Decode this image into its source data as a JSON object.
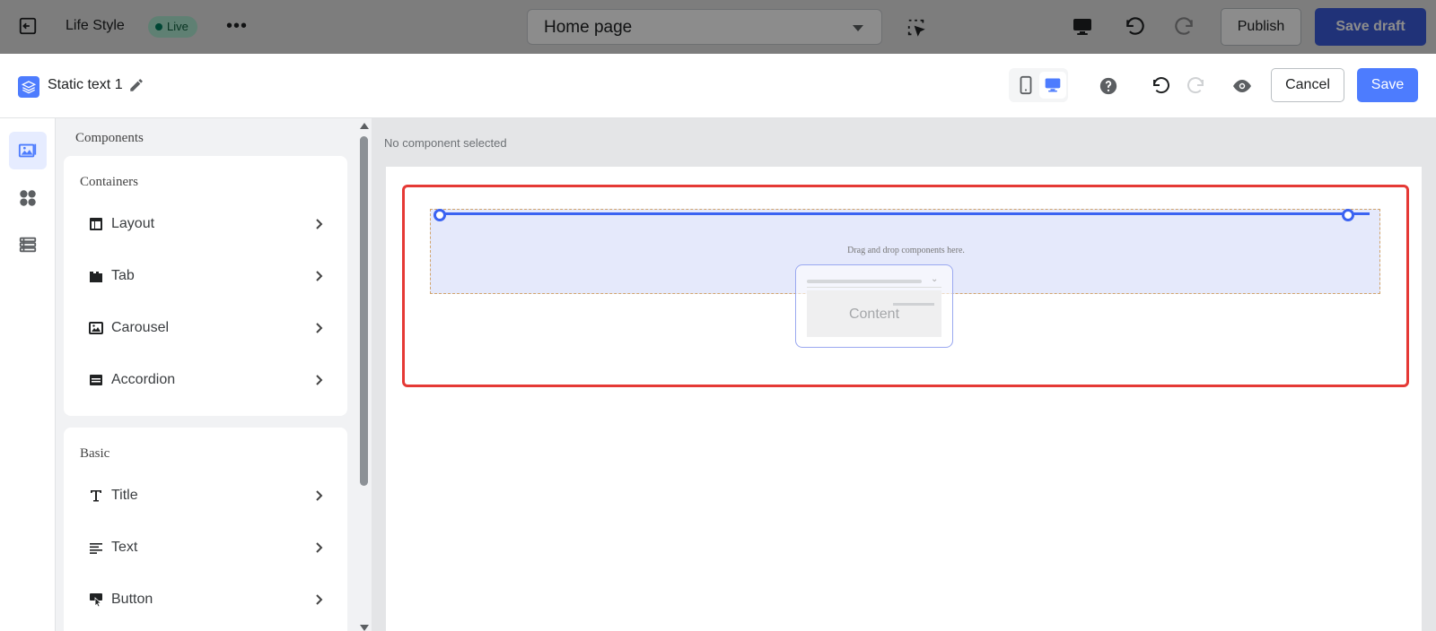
{
  "topbar": {
    "store_name": "Life Style",
    "live_badge": "Live",
    "more_label": "•••",
    "page_select": "Home page",
    "publish_label": "Publish",
    "save_draft_label": "Save draft"
  },
  "editor": {
    "component_name": "Static text 1",
    "cancel_label": "Cancel",
    "save_label": "Save",
    "accent_color": "#4d7cfe"
  },
  "panel": {
    "title": "Components",
    "containers": {
      "title": "Containers",
      "items": [
        {
          "label": "Layout",
          "icon": "layout-icon"
        },
        {
          "label": "Tab",
          "icon": "tab-icon"
        },
        {
          "label": "Carousel",
          "icon": "image-icon"
        },
        {
          "label": "Accordion",
          "icon": "accordion-icon"
        }
      ]
    },
    "basic": {
      "title": "Basic",
      "items": [
        {
          "label": "Title",
          "icon": "title-icon"
        },
        {
          "label": "Text",
          "icon": "text-icon"
        },
        {
          "label": "Button",
          "icon": "button-icon"
        }
      ]
    }
  },
  "canvas": {
    "status": "No component selected",
    "drop_hint": "Drag and drop components here.",
    "ghost_label": "Content",
    "highlight_color": "#e53935"
  }
}
